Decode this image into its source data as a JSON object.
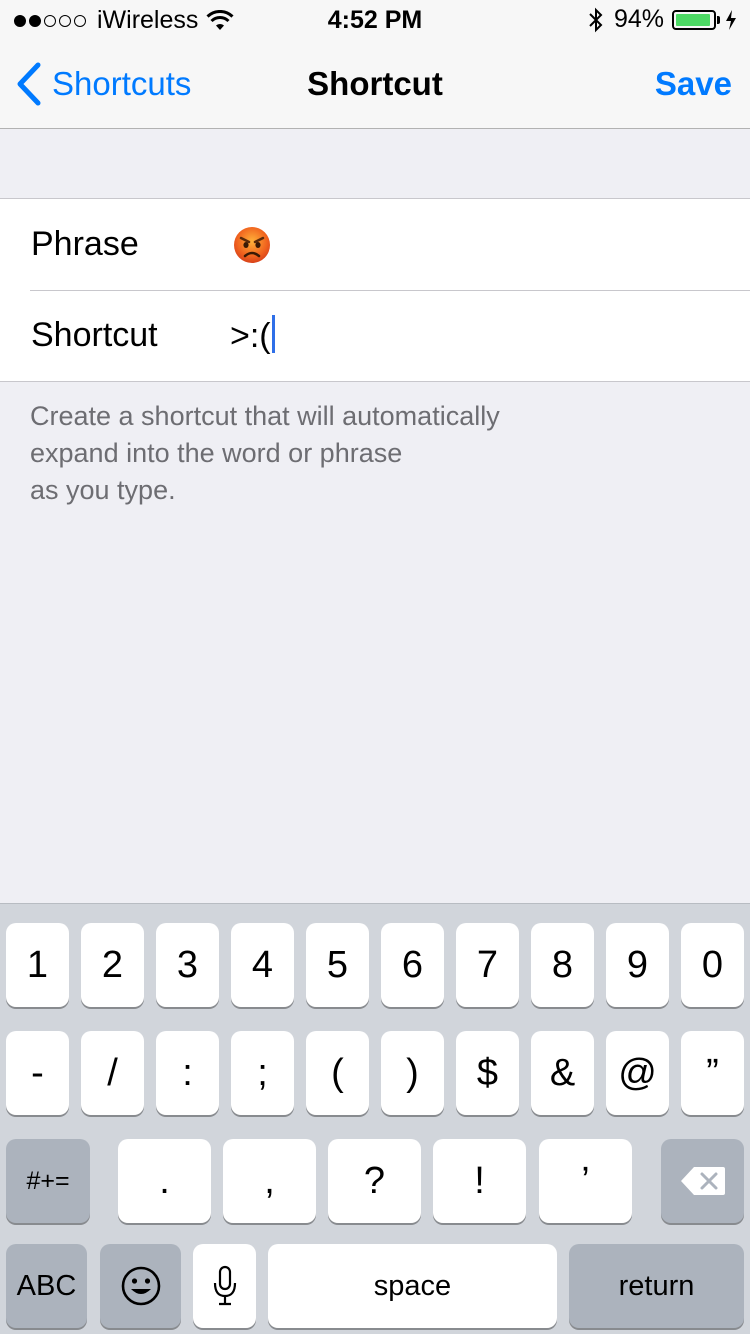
{
  "status_bar": {
    "signal_dots": [
      true,
      true,
      false,
      false,
      false
    ],
    "carrier": "iWireless",
    "time": "4:52 PM",
    "battery_percent": "94%",
    "battery_level": 0.94,
    "battery_color": "#4cd964"
  },
  "nav": {
    "back_label": "Shortcuts",
    "title": "Shortcut",
    "save_label": "Save",
    "accent_color": "#007aff"
  },
  "form": {
    "phrase_label": "Phrase",
    "phrase_value_icon": "angry-face-emoji",
    "shortcut_label": "Shortcut",
    "shortcut_value": ">:("
  },
  "footer_note": "Create a shortcut that will automatically\n expand into the word or phrase\n as you type.",
  "keyboard": {
    "row1": [
      "1",
      "2",
      "3",
      "4",
      "5",
      "6",
      "7",
      "8",
      "9",
      "0"
    ],
    "row2": [
      "-",
      "/",
      ":",
      ";",
      "(",
      ")",
      "$",
      "&",
      "@",
      "”"
    ],
    "row3": {
      "symbols_label": "#+=",
      "keys": [
        ".",
        ",",
        "?",
        "!",
        "’"
      ],
      "delete_icon": "backspace-icon"
    },
    "row4": {
      "abc_label": "ABC",
      "emoji_icon": "smiley-icon",
      "mic_icon": "microphone-icon",
      "space_label": "space",
      "return_label": "return"
    }
  }
}
